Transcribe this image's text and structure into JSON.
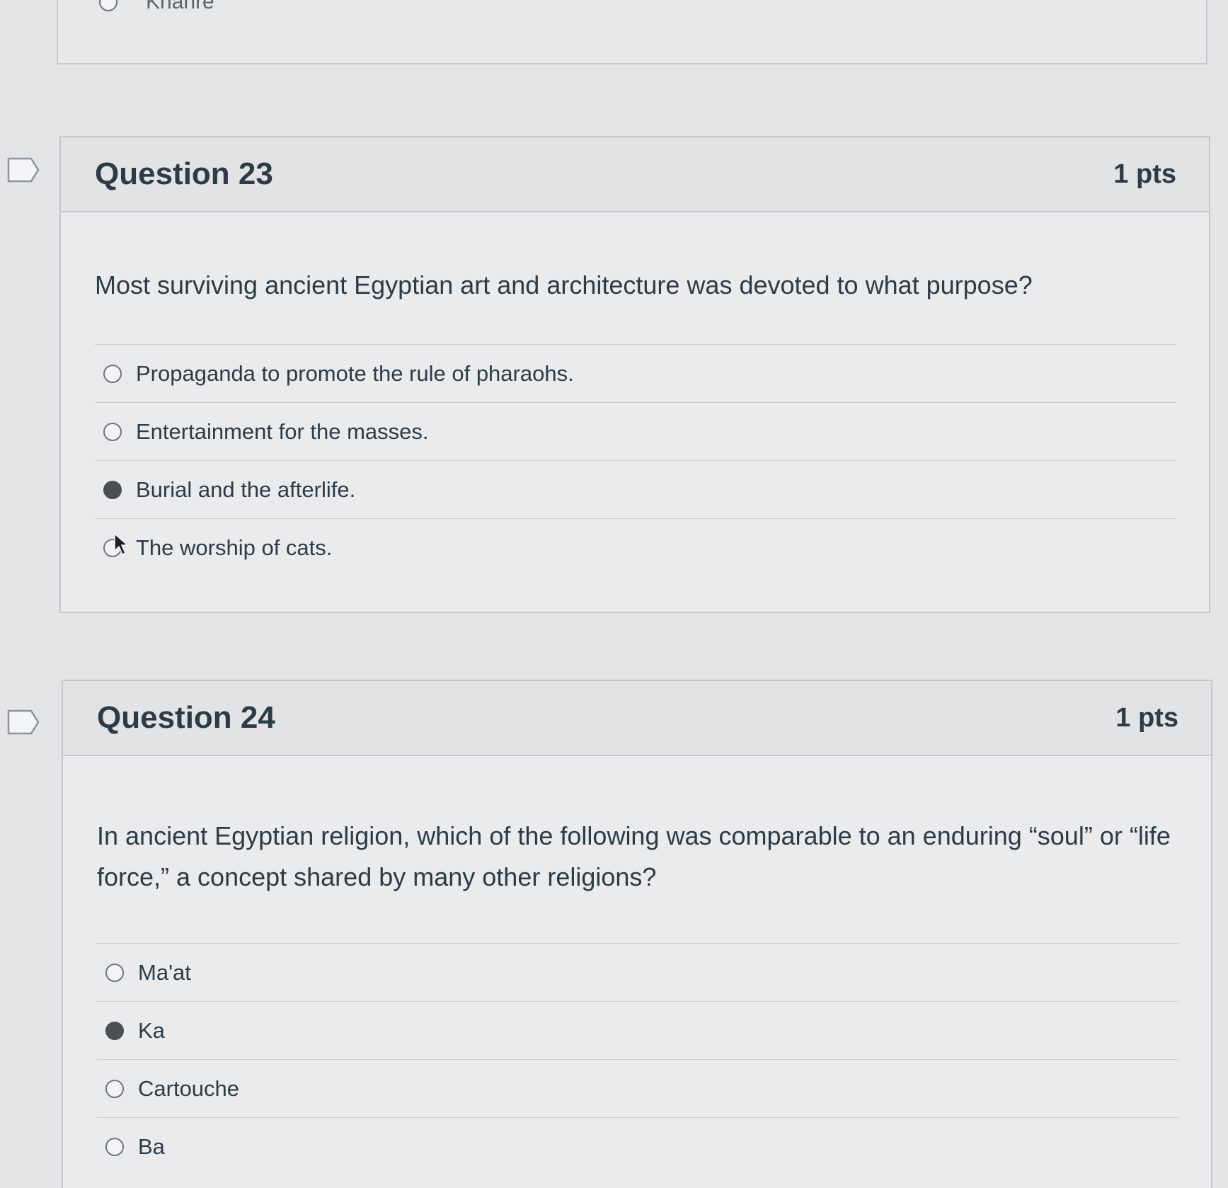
{
  "prev_question": {
    "answer_label": "Khanre"
  },
  "questions": [
    {
      "title": "Question 23",
      "points": "1 pts",
      "text": "Most surviving ancient Egyptian art and architecture was devoted to what purpose?",
      "answers": [
        {
          "label": "Propaganda to promote the rule of pharaohs.",
          "selected": false
        },
        {
          "label": "Entertainment for the masses.",
          "selected": false
        },
        {
          "label": "Burial and the afterlife.",
          "selected": true
        },
        {
          "label": "The worship of cats.",
          "selected": false
        }
      ]
    },
    {
      "title": "Question 24",
      "points": "1 pts",
      "text": "In ancient Egyptian religion, which of the following was comparable to an enduring “soul” or “life force,” a concept shared by many other religions?",
      "answers": [
        {
          "label": "Ma'at",
          "selected": false
        },
        {
          "label": "Ka",
          "selected": true
        },
        {
          "label": "Cartouche",
          "selected": false
        },
        {
          "label": "Ba",
          "selected": false
        }
      ]
    }
  ],
  "icons": {
    "flag": "flag-icon",
    "radio": "radio-button-icon",
    "cursor": "mouse-pointer-icon"
  }
}
